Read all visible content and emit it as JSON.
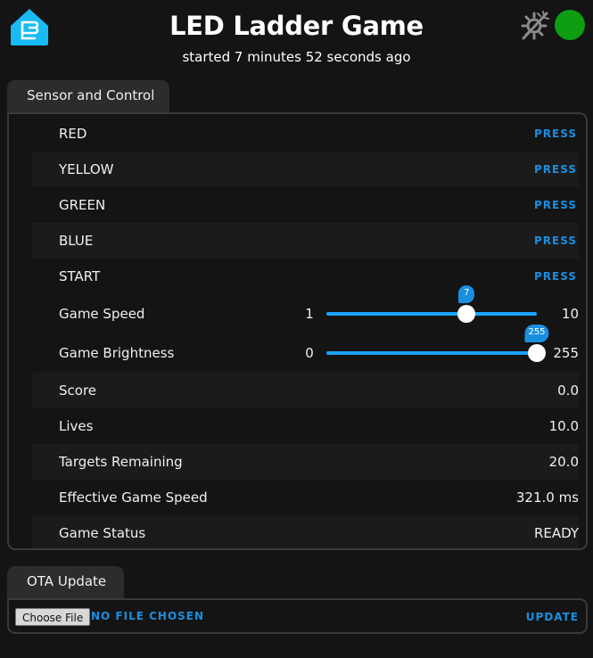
{
  "header": {
    "title": "LED Ladder Game",
    "subtitle": "started 7 minutes 52 seconds ago",
    "logo_icon": "esphome-logo-icon",
    "theme_icon": "theme-toggle-icon",
    "status_color": "#0d9e12"
  },
  "sensor_tab": {
    "label": "Sensor and Control"
  },
  "buttons": [
    {
      "label": "RED",
      "action": "PRESS"
    },
    {
      "label": "YELLOW",
      "action": "PRESS"
    },
    {
      "label": "GREEN",
      "action": "PRESS"
    },
    {
      "label": "BLUE",
      "action": "PRESS"
    },
    {
      "label": "START",
      "action": "PRESS"
    }
  ],
  "sliders": [
    {
      "label": "Game Speed",
      "min": "1",
      "max": "10",
      "value": "7",
      "fraction": 0.6667
    },
    {
      "label": "Game Brightness",
      "min": "0",
      "max": "255",
      "value": "255",
      "fraction": 1.0
    }
  ],
  "sensors": [
    {
      "label": "Score",
      "value": "0.0"
    },
    {
      "label": "Lives",
      "value": "10.0"
    },
    {
      "label": "Targets Remaining",
      "value": "20.0"
    },
    {
      "label": "Effective Game Speed",
      "value": "321.0 ms"
    },
    {
      "label": "Game Status",
      "value": "READY"
    }
  ],
  "ota_tab": {
    "label": "OTA Update"
  },
  "ota": {
    "choose_file": "Choose File",
    "file_status": "NO FILE CHOSEN",
    "update": "UPDATE"
  },
  "colors": {
    "accent": "#1a8fe0",
    "slider": "#1aa3ff",
    "background": "#141414"
  }
}
